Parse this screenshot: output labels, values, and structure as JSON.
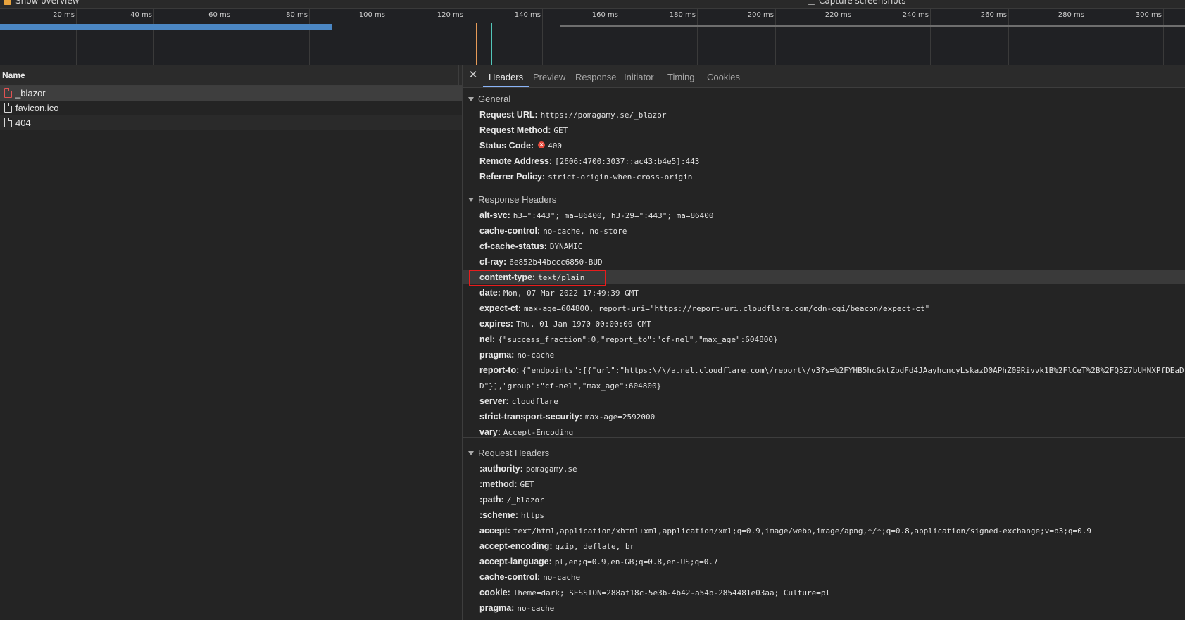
{
  "toolbar": {
    "show_overview_label": "Show overview",
    "capture_screenshots_label": "Capture screenshots"
  },
  "overview": {
    "tick_labels": [
      "20 ms",
      "40 ms",
      "60 ms",
      "80 ms",
      "100 ms",
      "120 ms",
      "140 ms",
      "160 ms",
      "180 ms",
      "200 ms",
      "220 ms",
      "240 ms",
      "260 ms",
      "280 ms",
      "300 ms"
    ]
  },
  "requests": {
    "header": "Name",
    "items": [
      {
        "name": "_blazor",
        "status": "error"
      },
      {
        "name": "favicon.ico",
        "status": "ok"
      },
      {
        "name": "404",
        "status": "ok"
      }
    ]
  },
  "details": {
    "tabs": [
      "Headers",
      "Preview",
      "Response",
      "Initiator",
      "Timing",
      "Cookies"
    ],
    "active_tab": "Headers",
    "general": {
      "title": "General",
      "rows": [
        {
          "key": "Request URL:",
          "value": "https://pomagamy.se/_blazor"
        },
        {
          "key": "Request Method:",
          "value": "GET"
        },
        {
          "key": "Status Code:",
          "value": "400"
        },
        {
          "key": "Remote Address:",
          "value": "[2606:4700:3037::ac43:b4e5]:443"
        },
        {
          "key": "Referrer Policy:",
          "value": "strict-origin-when-cross-origin"
        }
      ]
    },
    "response_headers": {
      "title": "Response Headers",
      "rows": [
        {
          "key": "alt-svc:",
          "value": "h3=\":443\"; ma=86400, h3-29=\":443\"; ma=86400"
        },
        {
          "key": "cache-control:",
          "value": "no-cache, no-store"
        },
        {
          "key": "cf-cache-status:",
          "value": "DYNAMIC"
        },
        {
          "key": "cf-ray:",
          "value": "6e852b44bccc6850-BUD"
        },
        {
          "key": "content-type:",
          "value": "text/plain"
        },
        {
          "key": "date:",
          "value": "Mon, 07 Mar 2022 17:49:39 GMT"
        },
        {
          "key": "expect-ct:",
          "value": "max-age=604800, report-uri=\"https://report-uri.cloudflare.com/cdn-cgi/beacon/expect-ct\""
        },
        {
          "key": "expires:",
          "value": "Thu, 01 Jan 1970 00:00:00 GMT"
        },
        {
          "key": "nel:",
          "value": "{\"success_fraction\":0,\"report_to\":\"cf-nel\",\"max_age\":604800}"
        },
        {
          "key": "pragma:",
          "value": "no-cache"
        },
        {
          "key": "report-to:",
          "value": "{\"endpoints\":[{\"url\":\"https:\\/\\/a.nel.cloudflare.com\\/report\\/v3?s=%2FYHB5hcGktZbdFd4JAayhcncyLskazD0APhZ09Rivvk1B%2FlCeT%2B%2FQ3Z7bUHNXPfDEaD",
          "continuation": "D\"}],\"group\":\"cf-nel\",\"max_age\":604800}"
        },
        {
          "key": "server:",
          "value": "cloudflare"
        },
        {
          "key": "strict-transport-security:",
          "value": "max-age=2592000"
        },
        {
          "key": "vary:",
          "value": "Accept-Encoding"
        }
      ]
    },
    "request_headers": {
      "title": "Request Headers",
      "rows": [
        {
          "key": ":authority:",
          "value": "pomagamy.se"
        },
        {
          "key": ":method:",
          "value": "GET"
        },
        {
          "key": ":path:",
          "value": "/_blazor"
        },
        {
          "key": ":scheme:",
          "value": "https"
        },
        {
          "key": "accept:",
          "value": "text/html,application/xhtml+xml,application/xml;q=0.9,image/webp,image/apng,*/*;q=0.8,application/signed-exchange;v=b3;q=0.9"
        },
        {
          "key": "accept-encoding:",
          "value": "gzip, deflate, br"
        },
        {
          "key": "accept-language:",
          "value": "pl,en;q=0.9,en-GB;q=0.8,en-US;q=0.7"
        },
        {
          "key": "cache-control:",
          "value": "no-cache"
        },
        {
          "key": "cookie:",
          "value": "Theme=dark; SESSION=288af18c-5e3b-4b42-a54b-2854481e03aa; Culture=pl"
        },
        {
          "key": "pragma:",
          "value": "no-cache"
        }
      ]
    }
  },
  "colors": {
    "highlight_box": "#e81c1c",
    "active_tab_underline": "#8ab4f8",
    "timeline_bar": "#4b87c4",
    "dom_content_loaded_line": "#e59a57",
    "load_line": "#52c6b9"
  }
}
